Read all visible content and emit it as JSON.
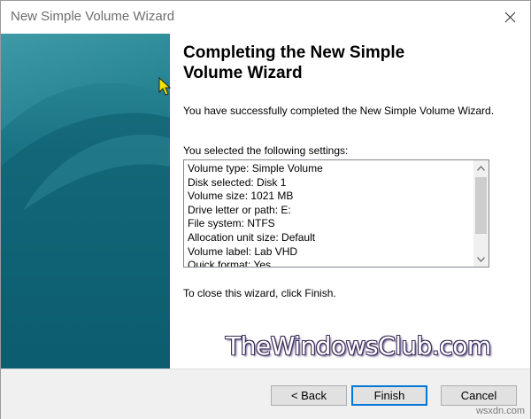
{
  "window": {
    "title": "New Simple Volume Wizard"
  },
  "content": {
    "heading": "Completing the New Simple Volume Wizard",
    "description": "You have successfully completed the New Simple Volume Wizard.",
    "settings_label": "You selected the following settings:",
    "settings": [
      "Volume type: Simple Volume",
      "Disk selected: Disk 1",
      "Volume size: 1021 MB",
      "Drive letter or path: E:",
      "File system: NTFS",
      "Allocation unit size: Default",
      "Volume label: Lab VHD",
      "Quick format: Yes"
    ],
    "close_instruction": "To close this wizard, click Finish."
  },
  "buttons": {
    "back": "< Back",
    "finish": "Finish",
    "cancel": "Cancel"
  },
  "watermark": {
    "text": "TheWindowsClub.com",
    "site": "wsxdn.com"
  },
  "colors": {
    "banner_teal": "#0f6b7d",
    "default_button_border": "#0078d7",
    "cursor_yellow": "#f2e400"
  },
  "icons": {
    "close": "close-icon",
    "scroll_up": "chevron-up-icon",
    "scroll_down": "chevron-down-icon",
    "cursor": "mouse-pointer-icon"
  }
}
